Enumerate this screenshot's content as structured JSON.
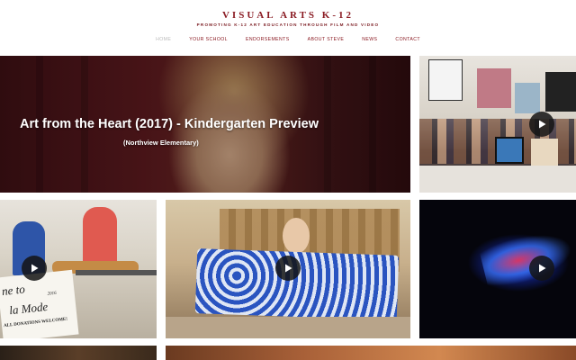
{
  "site": {
    "title": "VISUAL ARTS K-12",
    "tagline": "PROMOTING K-12 ART EDUCATION THROUGH FILM AND VIDEO"
  },
  "nav": {
    "items": [
      {
        "label": "HOME",
        "active": true
      },
      {
        "label": "YOUR SCHOOL",
        "active": false
      },
      {
        "label": "ENDORSEMENTS",
        "active": false
      },
      {
        "label": "ABOUT STEVE",
        "active": false
      },
      {
        "label": "NEWS",
        "active": false
      },
      {
        "label": "CONTACT",
        "active": false
      }
    ]
  },
  "hero": {
    "title": "Art from the Heart (2017) - Kindergarten Preview",
    "subtitle": "(Northview Elementary)"
  },
  "tiles": {
    "kids_sign": {
      "line1": "ne to",
      "line2": "la Mode",
      "line3": "2016",
      "line4": "ALL DONATIONS WELCOME!"
    }
  },
  "icons": {
    "play": "play-icon"
  },
  "colors": {
    "brand": "#8a1a22",
    "nav_active": "#bbbbbb",
    "background": "#ffffff"
  }
}
